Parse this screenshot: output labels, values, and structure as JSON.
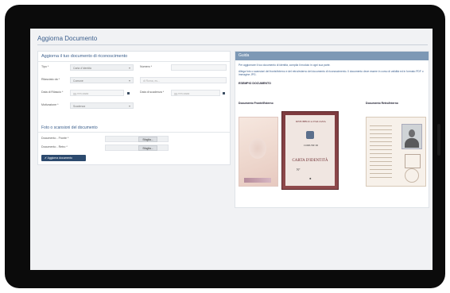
{
  "page": {
    "title": "Aggiorna Documento"
  },
  "form": {
    "header": "Aggiorna il tuo documento di riconoscimento",
    "fields": {
      "tipo": {
        "label": "Tipo *",
        "value": "Carta d'Identità"
      },
      "numero": {
        "label": "Numero *",
        "value": ""
      },
      "rilasciato": {
        "label": "Rilasciato da *",
        "value": "Comune"
      },
      "rilasciato_detail": {
        "placeholder": "di Roma, es..."
      },
      "data_rilascio": {
        "label": "Data di Rilascio *",
        "placeholder": "gg-mm-aaaa"
      },
      "data_scadenza": {
        "label": "Data di scadenza *",
        "placeholder": "gg-mm-aaaa"
      },
      "motivazione": {
        "label": "Motivazione *",
        "value": "Scadenza"
      }
    },
    "scan_section": "Foto o scansioni del documento",
    "files": [
      {
        "label": "Documento - Fronte *",
        "button": "Sfoglia..."
      },
      {
        "label": "Documento - Retro *",
        "button": "Sfoglia..."
      }
    ],
    "submit": "✔ Aggiorna documento"
  },
  "guide": {
    "header": "Guida",
    "text1": "Per aggiornare il tuo documento di identità, compila il modulo in ogni sua parte.",
    "text2": "Allega foto o scansioni del fronte/interno e del retro/esterno del documento di riconoscimento. Il documento deve essere in corso di validità ed in formato PDF o immagine JPG.",
    "example_title": "ESEMPIO DOCUMENTO",
    "caption_front": "Documento Fronte/Esterno",
    "caption_rear": "Documento Retro/Interno",
    "card_text": {
      "republic": "REPUBBLICA ITALIANA",
      "comune": "COMUNE DI",
      "card_title": "CARTA D'IDENTITÀ",
      "number_prefix": "N°",
      "signature_mark": "✱"
    }
  }
}
